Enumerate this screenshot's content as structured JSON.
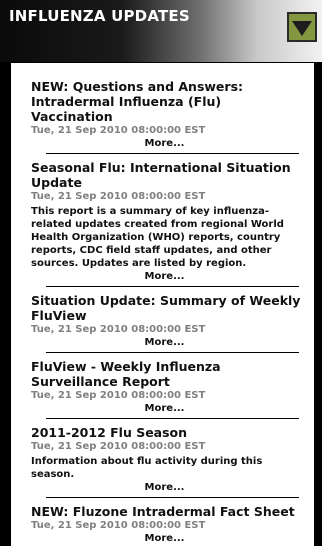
{
  "header": {
    "title": "INFLUENZA UPDATES",
    "toggle_icon": "triangle-down-icon",
    "toggle_color": "#839640"
  },
  "items": [
    {
      "title": "NEW: Questions and Answers: Intradermal Influenza (Flu) Vaccination",
      "date": "Tue, 21 Sep 2010 08:00:00 EST",
      "description": "",
      "more": "More..."
    },
    {
      "title": "Seasonal Flu: International Situation Update",
      "date": "Tue, 21 Sep 2010 08:00:00 EST",
      "description": "This report is a summary of key influenza-related updates created from regional World Health Organization (WHO) reports, country reports, CDC field staff updates, and other sources. Updates are listed by region.",
      "more": "More..."
    },
    {
      "title": "Situation Update: Summary of Weekly FluView",
      "date": "Tue, 21 Sep 2010 08:00:00 EST",
      "description": "",
      "more": "More..."
    },
    {
      "title": "FluView - Weekly Influenza Surveillance Report",
      "date": "Tue, 21 Sep 2010 08:00:00 EST",
      "description": "",
      "more": "More..."
    },
    {
      "title": "2011-2012 Flu Season",
      "date": "Tue, 21 Sep 2010 08:00:00 EST",
      "description": "Information about flu activity during this season.",
      "more": "More..."
    },
    {
      "title": "NEW: Fluzone Intradermal Fact Sheet",
      "date": "Tue, 21 Sep 2010 08:00:00 EST",
      "description": "",
      "more": "More..."
    }
  ]
}
